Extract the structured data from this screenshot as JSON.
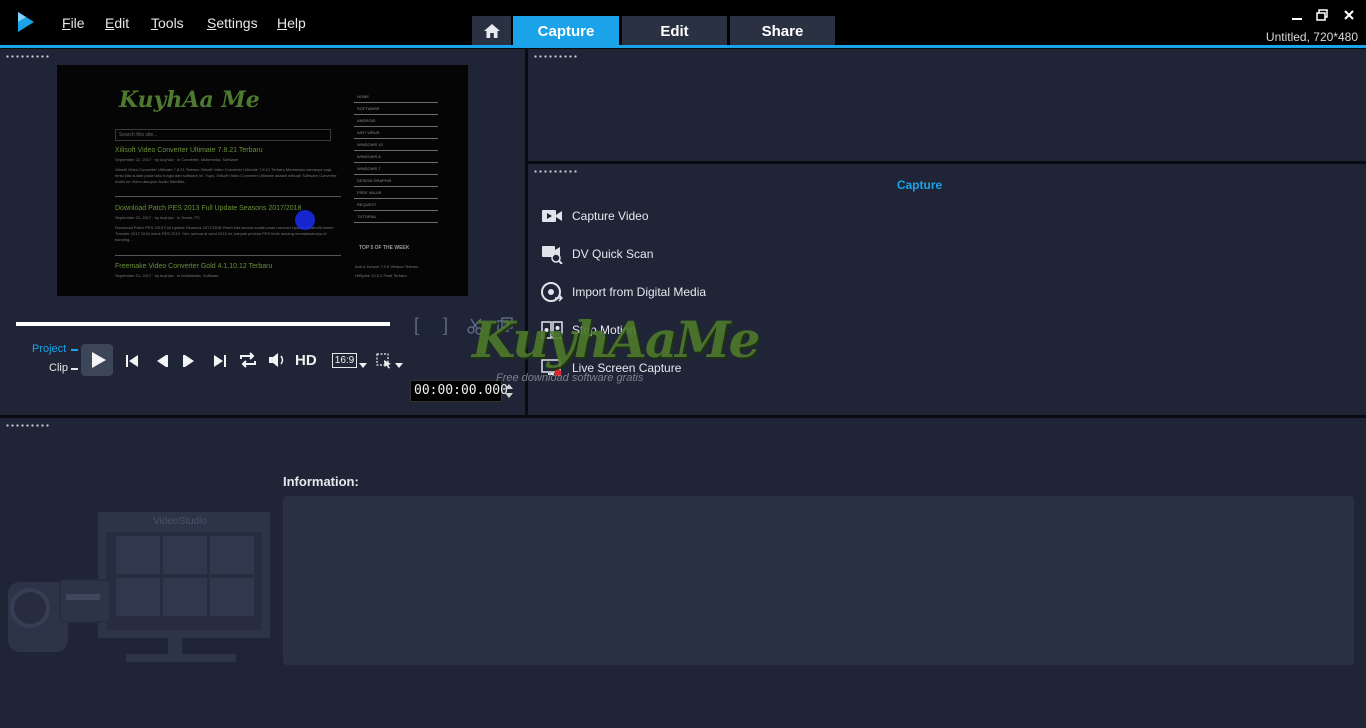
{
  "menu": {
    "file": "File",
    "edit": "Edit",
    "tools": "Tools",
    "settings": "Settings",
    "help": "Help"
  },
  "tabs": {
    "capture": "Capture",
    "edit": "Edit",
    "share": "Share"
  },
  "window": {
    "project_info": "Untitled, 720*480"
  },
  "preview": {
    "site_logo": "KuyhAa Me",
    "search_placeholder": "Search this site...",
    "posts": [
      {
        "title": "Xilisoft Video Converter Ultimate 7.8.21 Terbaru",
        "meta": "September 22, 2017 · by kuyhAa · in Converter, Multimedia, Software",
        "text": "Xilisoft Video Converter Ultimate 7.8.21 Terbaru Xilisoft Video Converter Ultimate 7.8.21 Terbaru Merentaka namanya saja, tentu kita sudah pada tahu fungsi dari software ini. Yups, Xilisoft Video Converter Ultimate adalah sebuah Software Converter Audio ke Video ataupun Audio Memiliki..."
      },
      {
        "title": "Download Patch PES 2013 Full Update Seasons 2017/2018",
        "meta": "September 22, 2017 · by kuyhAa · in Game, PC",
        "text": "Download Patch PES 2013 Full Update Seasons 2017/2018 Patch kita semua sudah pada mencari Update Musim/Summer Transfer 2017 2018 untuk PES 2013. Yah, semua di versi 2013 ini, banyak pecinta PES lebih senang memainkannya di banding..."
      },
      {
        "title": "Freemake Video Converter Gold 4.1.10.12 Terbaru",
        "meta": "September 21, 2017 · by kuyhAa · in Multimedia, Software",
        "text": ""
      }
    ],
    "nav": [
      "HOME",
      "SOFTWARE",
      "ANDROID",
      "ANTI VIRUS",
      "WINDOWS 10",
      "WINDOWS 8",
      "WINDOWS 7",
      "DESIGN GRAPHIS",
      "FREE VALUE",
      "REQUEST",
      "TUTORIAL"
    ],
    "top5_heading": "TOP 5 OF THE WEEK",
    "top5_items": [
      "Anti & Deluxe 7.0.0 Version Terbaru",
      "HitSpine 10.0.2 Final Terbaru"
    ]
  },
  "player": {
    "project_label": "Project",
    "clip_label": "Clip",
    "hd_label": "HD",
    "aspect_ratio": "16:9",
    "timecode": "00:00:00.000",
    "mark_in": "[",
    "mark_out": "]"
  },
  "options": {
    "title": "Capture",
    "items": [
      "Capture Video",
      "DV Quick Scan",
      "Import from Digital Media",
      "Stop Motion",
      "Live Screen Capture"
    ]
  },
  "info": {
    "label": "Information:"
  },
  "illustration": {
    "brand": "VideoStudio"
  },
  "watermark": {
    "logo": "KuyhAaMe",
    "tagline": "Free download software gratis"
  },
  "colors": {
    "accent": "#1aa3e8",
    "panel": "#1f2536",
    "tab": "#2a3142",
    "topbar": "#000000"
  }
}
